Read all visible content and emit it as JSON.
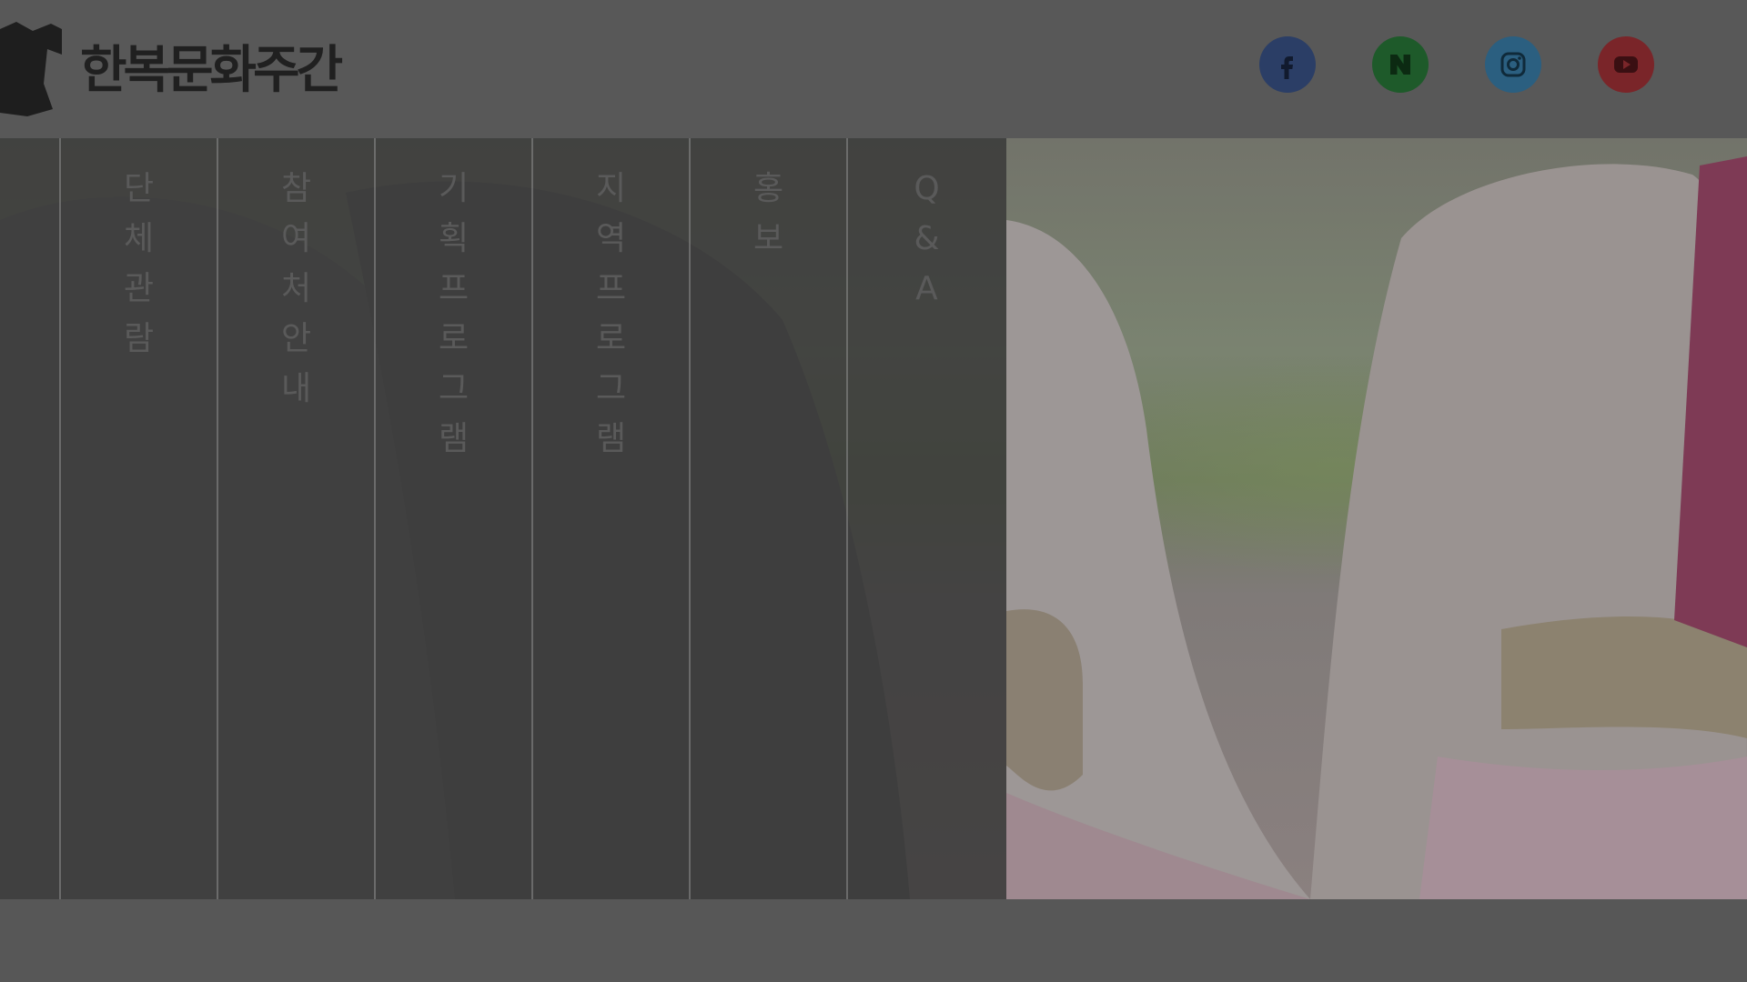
{
  "header": {
    "logo_text": "한복문화주간"
  },
  "socials": [
    {
      "name": "facebook-icon",
      "color": "#2b3e66"
    },
    {
      "name": "naver-icon",
      "color": "#1e5a2a"
    },
    {
      "name": "instagram-icon",
      "color": "#2b5f80"
    },
    {
      "name": "youtube-icon",
      "color": "#7a2529"
    }
  ],
  "menu": {
    "items": [
      {
        "label": "단체관람"
      },
      {
        "label": "참여처안내"
      },
      {
        "label": "기획프로그램"
      },
      {
        "label": "지역프로그램"
      },
      {
        "label": "홍보"
      },
      {
        "label": "Q&A"
      }
    ]
  }
}
